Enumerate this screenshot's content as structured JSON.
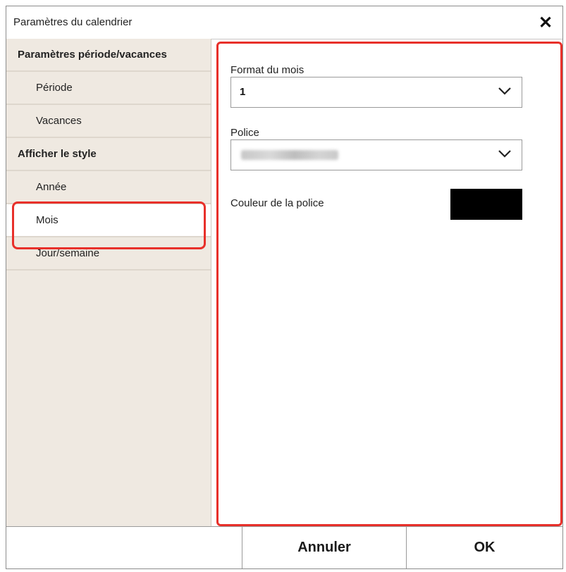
{
  "dialog": {
    "title": "Paramètres du calendrier",
    "close_icon": "close-x-icon"
  },
  "sidebar": {
    "items": [
      {
        "label": "Paramètres période/vacances",
        "kind": "section"
      },
      {
        "label": "Période",
        "kind": "sub"
      },
      {
        "label": "Vacances",
        "kind": "sub"
      },
      {
        "label": "Afficher le style",
        "kind": "section"
      },
      {
        "label": "Année",
        "kind": "sub"
      },
      {
        "label": "Mois",
        "kind": "sub",
        "selected": true
      },
      {
        "label": "Jour/semaine",
        "kind": "sub"
      }
    ]
  },
  "content": {
    "month_format": {
      "label": "Format du mois",
      "value": "1"
    },
    "font": {
      "label": "Police",
      "value_obscured": true
    },
    "font_color": {
      "label": "Couleur de la police",
      "color": "#000000"
    }
  },
  "footer": {
    "cancel_label": "Annuler",
    "ok_label": "OK"
  },
  "colors": {
    "sidebar_bg": "#efe9e1",
    "highlight": "#e8302a"
  }
}
